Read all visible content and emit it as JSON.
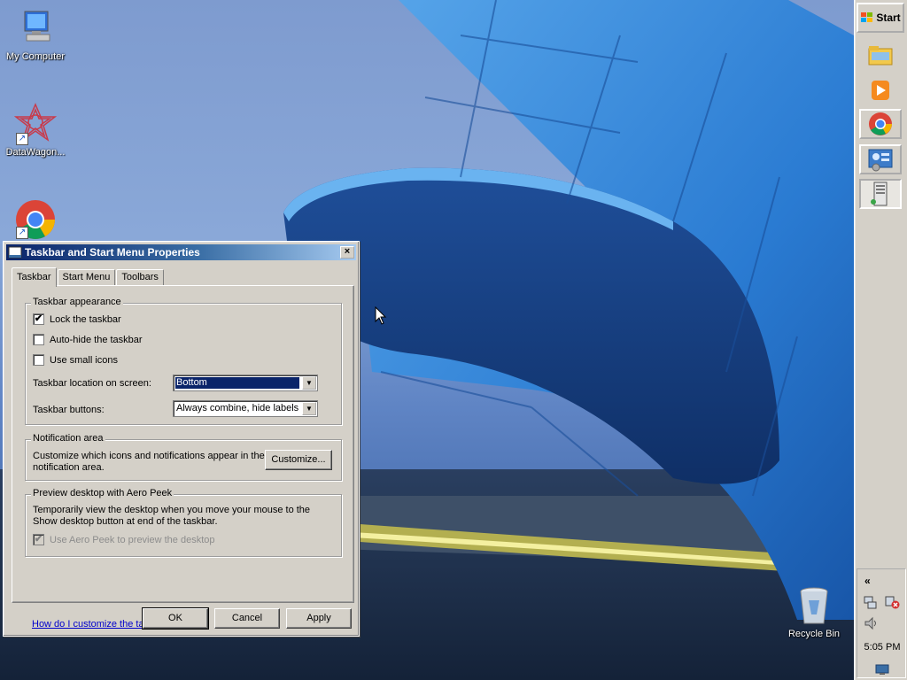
{
  "desktop": {
    "icons": [
      {
        "label": "My Computer",
        "icon": "my-computer-icon"
      },
      {
        "label": "DataWagon...",
        "icon": "datawagon-icon"
      },
      {
        "label": "",
        "icon": "chrome-icon"
      },
      {
        "label": "Recycle Bin",
        "icon": "recycle-bin-icon"
      }
    ]
  },
  "taskbar": {
    "start_label": "Start",
    "buttons": [
      {
        "icon": "explorer-folder-icon"
      },
      {
        "icon": "media-player-icon"
      },
      {
        "icon": "chrome-icon"
      },
      {
        "icon": "control-panel-icon"
      },
      {
        "icon": "computer-tower-icon"
      }
    ],
    "tray": {
      "expand": "«",
      "clock": "5:05 PM",
      "icons": [
        "network-icon",
        "network-error-icon",
        "volume-icon",
        "show-desktop-icon"
      ]
    }
  },
  "dialog": {
    "title": "Taskbar and Start Menu Properties",
    "close": "×",
    "tabs": [
      "Taskbar",
      "Start Menu",
      "Toolbars"
    ],
    "appearance": {
      "label": "Taskbar appearance",
      "lock": {
        "label": "Lock the taskbar",
        "checked": "✔"
      },
      "autohide": {
        "label": "Auto-hide the taskbar"
      },
      "small_icons": {
        "label": "Use small icons"
      },
      "location": {
        "label": "Taskbar location on screen:",
        "value": "Bottom"
      },
      "buttons": {
        "label": "Taskbar buttons:",
        "value": "Always combine, hide labels"
      }
    },
    "notification": {
      "label": "Notification area",
      "desc_line1": "Customize which icons and notifications appear in the",
      "desc_line2": "notification area.",
      "customize_label": "Customize..."
    },
    "peek": {
      "label": "Preview desktop with Aero Peek",
      "desc_line1": "Temporarily view the desktop when you move your mouse to the",
      "desc_line2": "Show desktop button at end of the taskbar.",
      "checkbox": {
        "label": "Use Aero Peek to preview the desktop",
        "checked": "✔"
      }
    },
    "help_link": "How do I customize the taskbar?",
    "ok_label": "OK",
    "cancel_label": "Cancel",
    "apply_label": "Apply"
  }
}
